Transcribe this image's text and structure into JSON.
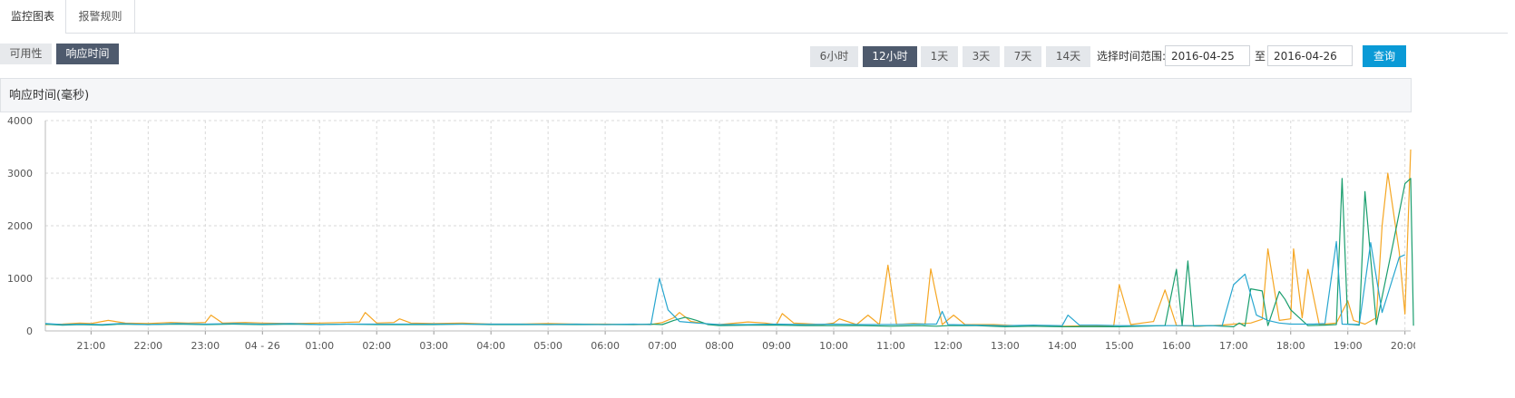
{
  "tabs": [
    {
      "label": "监控图表",
      "active": true
    },
    {
      "label": "报警规则",
      "active": false
    }
  ],
  "metrics": [
    {
      "label": "可用性",
      "active": false
    },
    {
      "label": "响应时间",
      "active": true
    }
  ],
  "ranges": [
    {
      "label": "6小时",
      "active": false
    },
    {
      "label": "12小时",
      "active": true
    },
    {
      "label": "1天",
      "active": false
    },
    {
      "label": "3天",
      "active": false
    },
    {
      "label": "7天",
      "active": false
    },
    {
      "label": "14天",
      "active": false
    }
  ],
  "range_picker": {
    "label": "选择时间范围:",
    "start": "2016-04-25",
    "separator": "至",
    "end": "2016-04-26",
    "query_label": "查询"
  },
  "colors": {
    "accent": "#0a9ad6",
    "active_button": "#4e5a6d",
    "series_orange": "#f5a623",
    "series_green": "#1a9e6e",
    "series_blue": "#27a6cf"
  },
  "chart_data": {
    "type": "line",
    "title": "响应时间(毫秒)",
    "xlabel": "",
    "ylabel": "",
    "ylim": [
      0,
      4000
    ],
    "yticks": [
      0,
      1000,
      2000,
      3000,
      4000
    ],
    "grid": true,
    "xlim": [
      20.2,
      44.1
    ],
    "xticks": [
      {
        "x": 21,
        "label": "21:00"
      },
      {
        "x": 22,
        "label": "22:00"
      },
      {
        "x": 23,
        "label": "23:00"
      },
      {
        "x": 24,
        "label": "04 - 26"
      },
      {
        "x": 25,
        "label": "01:00"
      },
      {
        "x": 26,
        "label": "02:00"
      },
      {
        "x": 27,
        "label": "03:00"
      },
      {
        "x": 28,
        "label": "04:00"
      },
      {
        "x": 29,
        "label": "05:00"
      },
      {
        "x": 30,
        "label": "06:00"
      },
      {
        "x": 31,
        "label": "07:00"
      },
      {
        "x": 32,
        "label": "08:00"
      },
      {
        "x": 33,
        "label": "09:00"
      },
      {
        "x": 34,
        "label": "10:00"
      },
      {
        "x": 35,
        "label": "11:00"
      },
      {
        "x": 36,
        "label": "12:00"
      },
      {
        "x": 37,
        "label": "13:00"
      },
      {
        "x": 38,
        "label": "14:00"
      },
      {
        "x": 39,
        "label": "15:00"
      },
      {
        "x": 40,
        "label": "16:00"
      },
      {
        "x": 41,
        "label": "17:00"
      },
      {
        "x": 42,
        "label": "18:00"
      },
      {
        "x": 43,
        "label": "19:00"
      },
      {
        "x": 44,
        "label": "20:00"
      }
    ],
    "series": [
      {
        "color": "#f5a623",
        "points": [
          [
            20.2,
            120
          ],
          [
            20.5,
            130
          ],
          [
            20.8,
            150
          ],
          [
            21.0,
            140
          ],
          [
            21.3,
            200
          ],
          [
            21.6,
            150
          ],
          [
            22.0,
            140
          ],
          [
            22.4,
            160
          ],
          [
            22.7,
            150
          ],
          [
            23.0,
            160
          ],
          [
            23.1,
            300
          ],
          [
            23.3,
            150
          ],
          [
            23.7,
            160
          ],
          [
            24.0,
            150
          ],
          [
            24.5,
            140
          ],
          [
            25.0,
            150
          ],
          [
            25.4,
            160
          ],
          [
            25.7,
            170
          ],
          [
            25.8,
            350
          ],
          [
            26.0,
            150
          ],
          [
            26.3,
            160
          ],
          [
            26.4,
            230
          ],
          [
            26.6,
            150
          ],
          [
            27.0,
            140
          ],
          [
            27.5,
            150
          ],
          [
            28.0,
            130
          ],
          [
            28.5,
            130
          ],
          [
            29.0,
            140
          ],
          [
            29.5,
            130
          ],
          [
            30.0,
            130
          ],
          [
            30.5,
            120
          ],
          [
            30.8,
            120
          ],
          [
            31.0,
            160
          ],
          [
            31.2,
            250
          ],
          [
            31.3,
            350
          ],
          [
            31.5,
            180
          ],
          [
            31.8,
            130
          ],
          [
            32.0,
            120
          ],
          [
            32.5,
            170
          ],
          [
            32.8,
            150
          ],
          [
            33.0,
            120
          ],
          [
            33.1,
            330
          ],
          [
            33.3,
            150
          ],
          [
            33.8,
            120
          ],
          [
            34.0,
            150
          ],
          [
            34.1,
            230
          ],
          [
            34.4,
            120
          ],
          [
            34.6,
            300
          ],
          [
            34.8,
            120
          ],
          [
            34.95,
            1250
          ],
          [
            35.1,
            120
          ],
          [
            35.4,
            140
          ],
          [
            35.6,
            130
          ],
          [
            35.7,
            1180
          ],
          [
            35.9,
            120
          ],
          [
            36.1,
            300
          ],
          [
            36.3,
            120
          ],
          [
            36.8,
            120
          ],
          [
            37.2,
            100
          ],
          [
            37.6,
            100
          ],
          [
            38.0,
            90
          ],
          [
            38.5,
            100
          ],
          [
            38.9,
            90
          ],
          [
            39.0,
            880
          ],
          [
            39.2,
            120
          ],
          [
            39.6,
            180
          ],
          [
            39.8,
            780
          ],
          [
            40.0,
            100
          ],
          [
            40.4,
            90
          ],
          [
            40.8,
            110
          ],
          [
            41.0,
            130
          ],
          [
            41.3,
            150
          ],
          [
            41.5,
            220
          ],
          [
            41.6,
            1560
          ],
          [
            41.8,
            200
          ],
          [
            42.0,
            230
          ],
          [
            42.05,
            1560
          ],
          [
            42.2,
            250
          ],
          [
            42.3,
            1170
          ],
          [
            42.5,
            120
          ],
          [
            42.8,
            150
          ],
          [
            43.0,
            570
          ],
          [
            43.1,
            200
          ],
          [
            43.3,
            130
          ],
          [
            43.5,
            250
          ],
          [
            43.6,
            2000
          ],
          [
            43.7,
            3000
          ],
          [
            43.9,
            1500
          ],
          [
            44.0,
            320
          ],
          [
            44.1,
            3450
          ]
        ]
      },
      {
        "color": "#1a9e6e",
        "points": [
          [
            20.2,
            130
          ],
          [
            20.5,
            110
          ],
          [
            20.8,
            120
          ],
          [
            21.2,
            110
          ],
          [
            21.5,
            130
          ],
          [
            22.0,
            120
          ],
          [
            22.5,
            130
          ],
          [
            23.0,
            120
          ],
          [
            23.5,
            130
          ],
          [
            24.0,
            120
          ],
          [
            24.5,
            130
          ],
          [
            25.0,
            120
          ],
          [
            25.5,
            130
          ],
          [
            26.0,
            120
          ],
          [
            26.5,
            120
          ],
          [
            27.0,
            120
          ],
          [
            27.5,
            130
          ],
          [
            28.0,
            120
          ],
          [
            28.5,
            120
          ],
          [
            29.0,
            120
          ],
          [
            29.5,
            120
          ],
          [
            30.0,
            120
          ],
          [
            30.5,
            120
          ],
          [
            30.8,
            130
          ],
          [
            31.0,
            120
          ],
          [
            31.2,
            200
          ],
          [
            31.4,
            260
          ],
          [
            31.6,
            200
          ],
          [
            31.8,
            120
          ],
          [
            32.0,
            100
          ],
          [
            32.5,
            110
          ],
          [
            33.0,
            110
          ],
          [
            33.5,
            100
          ],
          [
            34.0,
            100
          ],
          [
            34.5,
            100
          ],
          [
            35.0,
            90
          ],
          [
            35.5,
            100
          ],
          [
            35.8,
            90
          ],
          [
            36.0,
            100
          ],
          [
            36.5,
            100
          ],
          [
            37.0,
            80
          ],
          [
            37.5,
            90
          ],
          [
            38.0,
            80
          ],
          [
            38.5,
            80
          ],
          [
            39.0,
            80
          ],
          [
            39.4,
            90
          ],
          [
            39.8,
            100
          ],
          [
            40.0,
            1170
          ],
          [
            40.1,
            100
          ],
          [
            40.2,
            1330
          ],
          [
            40.3,
            90
          ],
          [
            40.6,
            100
          ],
          [
            41.0,
            80
          ],
          [
            41.1,
            150
          ],
          [
            41.2,
            90
          ],
          [
            41.3,
            800
          ],
          [
            41.5,
            760
          ],
          [
            41.6,
            100
          ],
          [
            41.8,
            750
          ],
          [
            41.9,
            600
          ],
          [
            42.0,
            400
          ],
          [
            42.3,
            100
          ],
          [
            42.6,
            110
          ],
          [
            42.8,
            120
          ],
          [
            42.9,
            2900
          ],
          [
            43.0,
            130
          ],
          [
            43.2,
            110
          ],
          [
            43.3,
            2650
          ],
          [
            43.5,
            120
          ],
          [
            43.8,
            1700
          ],
          [
            44.0,
            2800
          ],
          [
            44.1,
            2900
          ],
          [
            44.15,
            100
          ]
        ]
      },
      {
        "color": "#27a6cf",
        "points": [
          [
            20.2,
            140
          ],
          [
            20.5,
            120
          ],
          [
            20.8,
            130
          ],
          [
            21.2,
            120
          ],
          [
            21.5,
            140
          ],
          [
            22.0,
            120
          ],
          [
            22.5,
            140
          ],
          [
            23.0,
            130
          ],
          [
            23.5,
            140
          ],
          [
            24.0,
            130
          ],
          [
            24.5,
            140
          ],
          [
            25.0,
            120
          ],
          [
            25.5,
            130
          ],
          [
            26.0,
            130
          ],
          [
            26.5,
            130
          ],
          [
            27.0,
            130
          ],
          [
            27.5,
            130
          ],
          [
            28.0,
            130
          ],
          [
            28.5,
            130
          ],
          [
            29.0,
            120
          ],
          [
            29.5,
            130
          ],
          [
            30.0,
            120
          ],
          [
            30.5,
            130
          ],
          [
            30.8,
            120
          ],
          [
            30.95,
            1000
          ],
          [
            31.1,
            400
          ],
          [
            31.3,
            180
          ],
          [
            31.6,
            150
          ],
          [
            32.0,
            120
          ],
          [
            32.5,
            120
          ],
          [
            33.0,
            130
          ],
          [
            33.5,
            120
          ],
          [
            34.0,
            130
          ],
          [
            34.5,
            120
          ],
          [
            35.0,
            120
          ],
          [
            35.5,
            130
          ],
          [
            35.8,
            130
          ],
          [
            35.9,
            370
          ],
          [
            36.0,
            120
          ],
          [
            36.5,
            110
          ],
          [
            37.0,
            100
          ],
          [
            37.5,
            110
          ],
          [
            38.0,
            100
          ],
          [
            38.1,
            300
          ],
          [
            38.3,
            110
          ],
          [
            38.6,
            110
          ],
          [
            39.0,
            100
          ],
          [
            39.5,
            100
          ],
          [
            40.0,
            100
          ],
          [
            40.5,
            100
          ],
          [
            40.8,
            100
          ],
          [
            41.0,
            880
          ],
          [
            41.2,
            1080
          ],
          [
            41.4,
            300
          ],
          [
            41.6,
            200
          ],
          [
            41.8,
            150
          ],
          [
            42.0,
            130
          ],
          [
            42.2,
            130
          ],
          [
            42.4,
            130
          ],
          [
            42.6,
            140
          ],
          [
            42.8,
            1700
          ],
          [
            42.9,
            130
          ],
          [
            43.2,
            120
          ],
          [
            43.4,
            1680
          ],
          [
            43.6,
            350
          ],
          [
            43.9,
            1400
          ],
          [
            44.0,
            1450
          ]
        ]
      }
    ]
  }
}
